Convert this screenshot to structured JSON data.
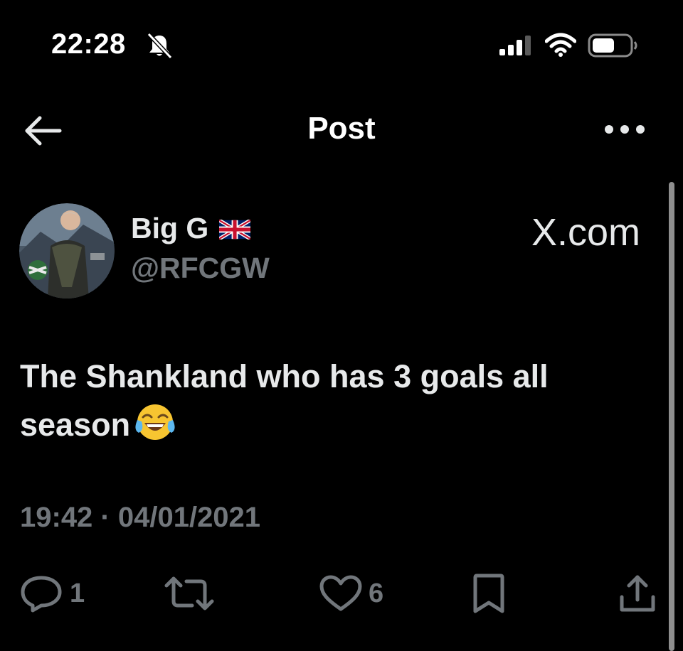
{
  "status_bar": {
    "time": "22:28"
  },
  "nav": {
    "title": "Post"
  },
  "author": {
    "display_name": "Big G",
    "handle": "@RFCGW"
  },
  "watermark": "X.com",
  "tweet": {
    "text": "The Shankland who has 3 goals all season",
    "emoji": "face-with-tears-of-joy"
  },
  "timestamp": "19:42 · 04/01/2021",
  "actions": {
    "reply_count": "1",
    "like_count": "6"
  },
  "colors": {
    "background": "#000000",
    "text_primary": "#e7e9ea",
    "text_secondary": "#71767b"
  }
}
